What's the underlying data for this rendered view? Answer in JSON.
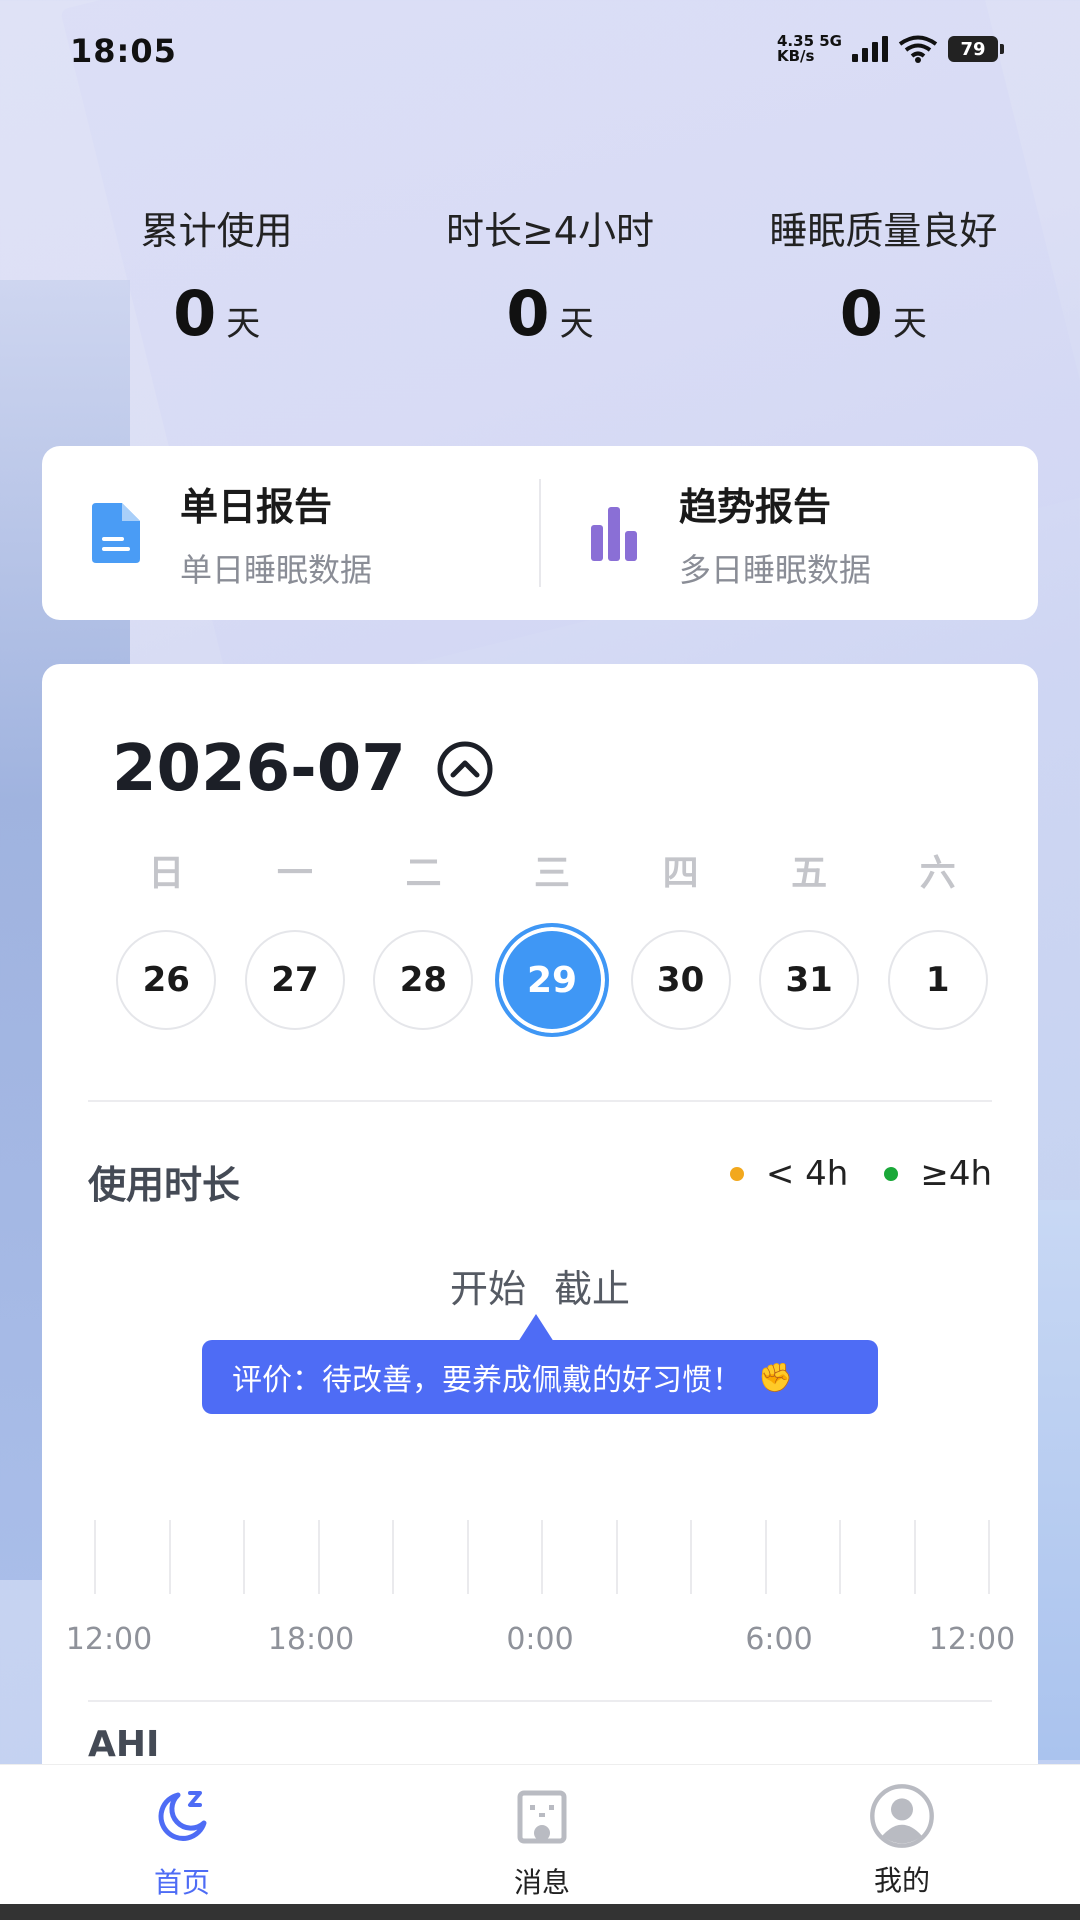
{
  "status_bar": {
    "time": "18:05",
    "net_speed_value": "4.35",
    "net_speed_unit": "KB/s",
    "network_type": "5G",
    "battery": "79"
  },
  "stats": [
    {
      "label": "累计使用",
      "value": "0",
      "unit": "天"
    },
    {
      "label": "时长≥4小时",
      "value": "0",
      "unit": "天"
    },
    {
      "label": "睡眠质量良好",
      "value": "0",
      "unit": "天"
    }
  ],
  "reports": {
    "daily": {
      "title": "单日报告",
      "subtitle": "单日睡眠数据",
      "icon": "document-icon",
      "color": "#4a9cf5"
    },
    "trend": {
      "title": "趋势报告",
      "subtitle": "多日睡眠数据",
      "icon": "bar-chart-icon",
      "color": "#8a6fd6"
    }
  },
  "calendar": {
    "month": "2026-07",
    "weekdays": [
      "日",
      "一",
      "二",
      "三",
      "四",
      "五",
      "六"
    ],
    "dates": [
      "26",
      "27",
      "28",
      "29",
      "30",
      "31",
      "1"
    ],
    "selected_index": 3,
    "selected_color": "#3f97f5"
  },
  "usage": {
    "title": "使用时长",
    "legend": [
      {
        "label": "< 4h",
        "color": "#f2a81d"
      },
      {
        "label": "≥4h",
        "color": "#1aa839"
      }
    ],
    "start_end": "开始 截止",
    "evaluation": "评价：待改善，要养成佩戴的好习惯！",
    "evaluation_icon": "✊",
    "timeline_labels": [
      "12:00",
      "18:00",
      "0:00",
      "6:00",
      "12:00"
    ]
  },
  "ahi": {
    "title": "AHI"
  },
  "nav": {
    "home": "首页",
    "messages": "消息",
    "mine": "我的",
    "active_color": "#4e6cf5"
  }
}
